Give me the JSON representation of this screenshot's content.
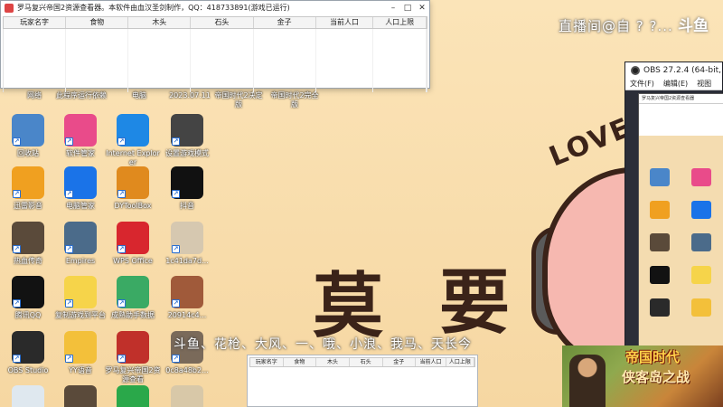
{
  "tool_window": {
    "title": "罗马复兴帝国2资源查看器。本软件由血汉圣剑制作，QQ：418733891(游戏已运行)",
    "columns": [
      "玩家名字",
      "食物",
      "木头",
      "石头",
      "金子",
      "当前人口",
      "人口上限"
    ]
  },
  "desktop_icons": [
    {
      "label": "回收站",
      "icon": "recycle-bin-icon",
      "color": "#4a86c9"
    },
    {
      "label": "软件管家",
      "icon": "software-manager-icon",
      "color": "#e94b8a"
    },
    {
      "label": "Internet Explorer",
      "icon": "internet-explorer-icon",
      "color": "#1e88e5"
    },
    {
      "label": "设置游戏模式",
      "icon": "game-mode-icon",
      "color": "#444444"
    },
    {
      "label": "迅雷影音",
      "icon": "thunder-player-icon",
      "color": "#f0a020"
    },
    {
      "label": "电脑管家",
      "icon": "pc-manager-icon",
      "color": "#1a73e8"
    },
    {
      "label": "DYToolBox",
      "icon": "dytoolbox-icon",
      "color": "#e08a1e"
    },
    {
      "label": "抖音",
      "icon": "douyin-icon",
      "color": "#111111"
    },
    {
      "label": "热血传奇",
      "icon": "dragon-game-icon",
      "color": "#5a4a3a"
    },
    {
      "label": "Empires",
      "icon": "empires-icon",
      "color": "#4b6b8a"
    },
    {
      "label": "WPS Office",
      "icon": "wps-office-icon",
      "color": "#d8262e"
    },
    {
      "label": "1c41da7d...",
      "icon": "file-thumbnail-icon",
      "color": "#d6c8b0"
    },
    {
      "label": "腾讯QQ",
      "icon": "qq-icon",
      "color": "#121212"
    },
    {
      "label": "复制游戏到平台",
      "icon": "duck-icon",
      "color": "#f6d44a"
    },
    {
      "label": "成熟助手数据",
      "icon": "assistant-icon",
      "color": "#3aaa64"
    },
    {
      "label": "20914c4...",
      "icon": "image-thumbnail-icon",
      "color": "#a05a3a"
    },
    {
      "label": "OBS Studio",
      "icon": "obs-studio-icon",
      "color": "#2a2a2a"
    },
    {
      "label": "YY语音",
      "icon": "yy-voice-icon",
      "color": "#f3c03a"
    },
    {
      "label": "罗马复兴帝国2资源查看",
      "icon": "roman-empire-icon",
      "color": "#c0302a"
    },
    {
      "label": "0c8a48b2...",
      "icon": "image-thumbnail-icon-2",
      "color": "#7a6a5a"
    },
    {
      "label": "",
      "icon": "polar-bear-icon",
      "color": "#dfe8ef"
    },
    {
      "label": "",
      "icon": "dragon-game-icon-2",
      "color": "#5a4a3a"
    },
    {
      "label": "",
      "icon": "edge-browser-icon",
      "color": "#2aa84a"
    },
    {
      "label": "",
      "icon": "folder-icon",
      "color": "#d8c8a8"
    }
  ],
  "top_row_labels": [
    "网络",
    "此程序运行依赖",
    "电脑",
    "2023.07.11",
    "帝国时代2决定版",
    "帝国时代2完全版"
  ],
  "wallpaper": {
    "char1": "莫",
    "char2": "要",
    "love": "LOVE"
  },
  "stream_overlay": {
    "text": "直播间@自 ? ?...",
    "logo": "斗鱼"
  },
  "subtitle": "斗鱼、花枪、大风、一、哦、小浪、我马、天长今",
  "obs": {
    "title": "OBS 27.2.4 (64-bit,",
    "menu": [
      "文件(F)",
      "编辑(E)",
      "视图"
    ],
    "preview_title": "罗马复兴帝国2资源查看器"
  },
  "game_banner": {
    "logo": "帝国时代",
    "subtitle": "侠客岛之战"
  }
}
